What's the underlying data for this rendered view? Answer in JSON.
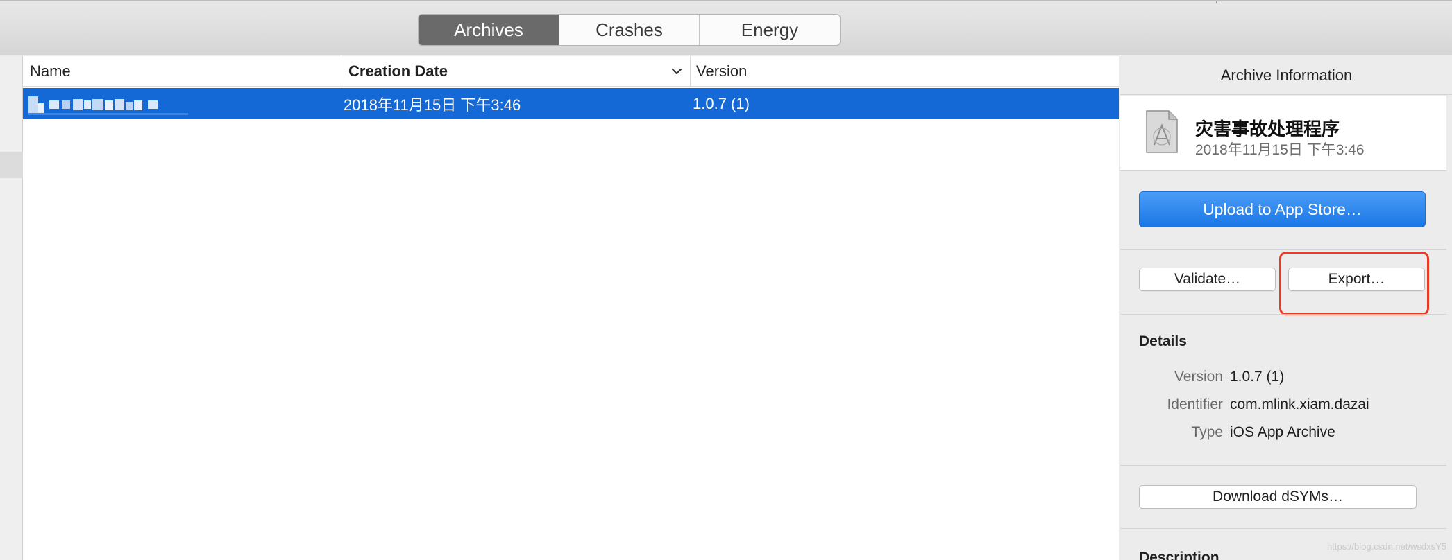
{
  "tabs": [
    {
      "label": "Archives",
      "active": true
    },
    {
      "label": "Crashes",
      "active": false
    },
    {
      "label": "Energy",
      "active": false
    }
  ],
  "table": {
    "columns": {
      "name": "Name",
      "date": "Creation Date",
      "version": "Version"
    },
    "rows": [
      {
        "name": "",
        "date": "2018年11月15日 下午3:46",
        "version": "1.0.7 (1)",
        "selected": true
      }
    ]
  },
  "inspector": {
    "title": "Archive Information",
    "app_name": "灾害事故处理程序",
    "app_date": "2018年11月15日 下午3:46",
    "upload_label": "Upload to App Store…",
    "validate_label": "Validate…",
    "export_label": "Export…",
    "details_title": "Details",
    "details": [
      {
        "label": "Version",
        "value": "1.0.7 (1)"
      },
      {
        "label": "Identifier",
        "value": "com.mlink.xiam.dazai"
      },
      {
        "label": "Type",
        "value": "iOS App Archive"
      }
    ],
    "dsym_label": "Download dSYMs…",
    "description_title": "Description"
  },
  "watermark": "https://blog.csdn.net/wsdxsY5",
  "colors": {
    "selection": "#1469d6",
    "primary_button": "#1b77e6",
    "highlight": "#ee3a22"
  },
  "icons": {
    "archive": "archive-document-icon",
    "sort": "chevron-down-icon"
  }
}
